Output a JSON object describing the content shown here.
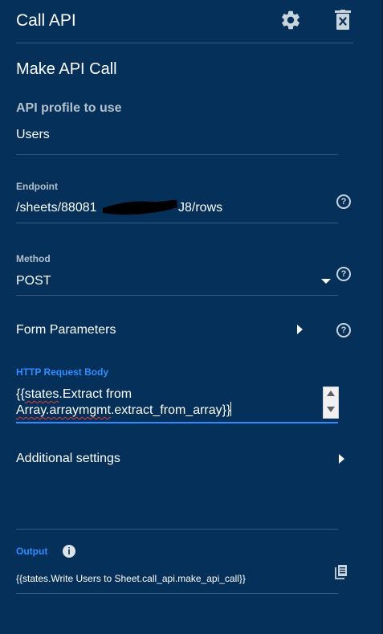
{
  "header": {
    "title": "Call API"
  },
  "section": {
    "title": "Make API Call"
  },
  "profile": {
    "label": "API profile to use",
    "value": "Users"
  },
  "endpoint": {
    "label": "Endpoint",
    "value": "/sheets/88081",
    "value_suffix": "J8/rows"
  },
  "method": {
    "label": "Method",
    "value": "POST"
  },
  "form_params": {
    "label": "Form Parameters"
  },
  "http_body": {
    "label": "HTTP Request Body",
    "line1_open": "{{",
    "line1_squiggle": "states",
    "line1_rest": ".Extract from",
    "line2_squiggle": "Array.arraymgmt",
    "line2_rest": ".extract_from_array}}"
  },
  "additional": {
    "label": "Additional settings"
  },
  "output": {
    "label": "Output",
    "value": "{{states.Write Users to Sheet.call_api.make_api_call}}"
  },
  "icons": {
    "help": "?",
    "info": "i"
  }
}
